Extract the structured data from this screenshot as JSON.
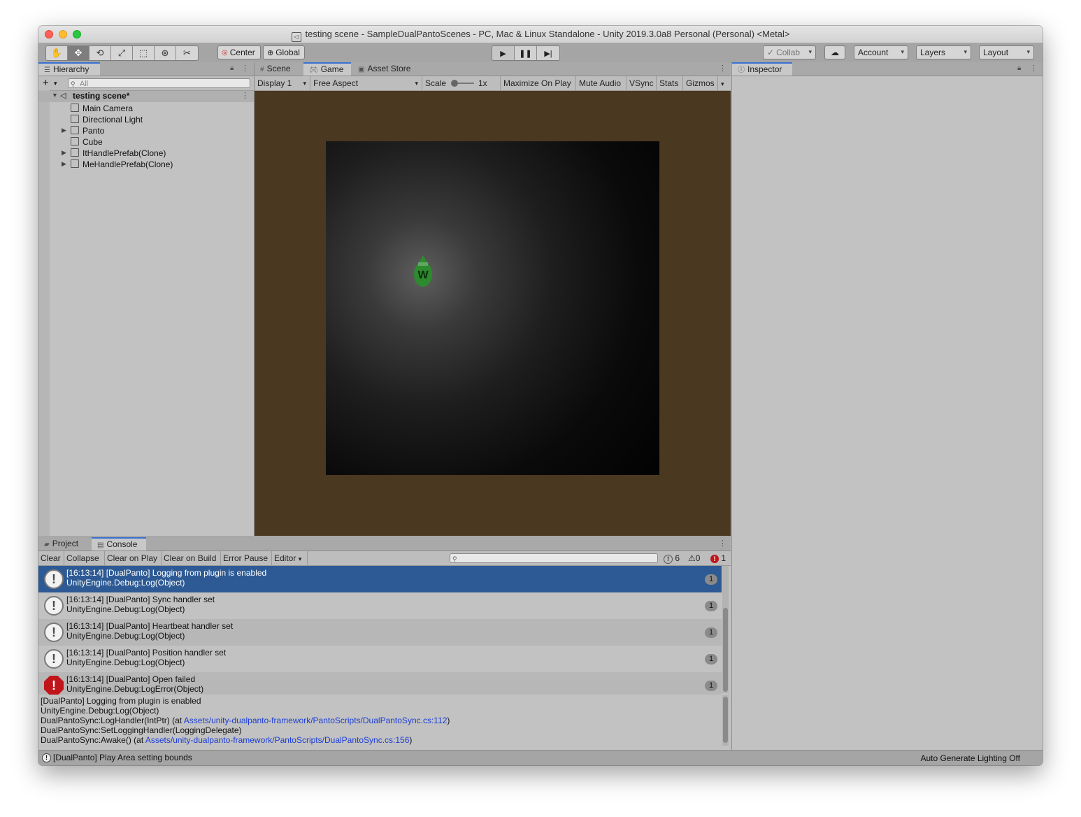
{
  "window": {
    "title": "testing scene - SampleDualPantoScenes - PC, Mac & Linux Standalone - Unity 2019.3.0a8 Personal (Personal) <Metal>"
  },
  "toolbar": {
    "pivot_label": "Center",
    "space_label": "Global",
    "collab_label": "Collab",
    "account_label": "Account",
    "layers_label": "Layers",
    "layout_label": "Layout"
  },
  "hierarchy": {
    "tab_label": "Hierarchy",
    "search_placeholder": "All",
    "scene_name": "testing scene*",
    "items": [
      {
        "label": "Main Camera"
      },
      {
        "label": "Directional Light"
      },
      {
        "label": "Panto"
      },
      {
        "label": "Cube"
      },
      {
        "label": "ItHandlePrefab(Clone)"
      },
      {
        "label": "MeHandlePrefab(Clone)"
      }
    ]
  },
  "center_tabs": {
    "scene": "Scene",
    "game": "Game",
    "asset_store": "Asset Store"
  },
  "game_toolbar": {
    "display": "Display 1",
    "aspect": "Free Aspect",
    "scale_label": "Scale",
    "scale_value": "1x",
    "maximize": "Maximize On Play",
    "mute": "Mute Audio",
    "vsync": "VSync",
    "stats": "Stats",
    "gizmos": "Gizmos"
  },
  "game_view": {
    "handle_glyph": "W",
    "colors": {
      "background": "#4a3820",
      "handle": "#2e8a2e"
    }
  },
  "inspector": {
    "tab_label": "Inspector"
  },
  "console": {
    "tab_project": "Project",
    "tab_console": "Console",
    "buttons": {
      "clear": "Clear",
      "collapse": "Collapse",
      "clear_on_play": "Clear on Play",
      "clear_on_build": "Clear on Build",
      "error_pause": "Error Pause",
      "editor": "Editor"
    },
    "counts": {
      "log": "6",
      "warning": "0",
      "error": "1"
    },
    "entries": [
      {
        "line1": "[16:13:14] [DualPanto] Logging from plugin is enabled",
        "line2": "UnityEngine.Debug:Log(Object)",
        "count": "1"
      },
      {
        "line1": "[16:13:14] [DualPanto] Sync handler set",
        "line2": "UnityEngine.Debug:Log(Object)",
        "count": "1"
      },
      {
        "line1": "[16:13:14] [DualPanto] Heartbeat handler set",
        "line2": "UnityEngine.Debug:Log(Object)",
        "count": "1"
      },
      {
        "line1": "[16:13:14] [DualPanto] Position handler set",
        "line2": "UnityEngine.Debug:Log(Object)",
        "count": "1"
      },
      {
        "line1": "[16:13:14] [DualPanto] Open failed",
        "line2": "UnityEngine.Debug:LogError(Object)",
        "count": "1"
      }
    ],
    "detail": {
      "line1": "[DualPanto] Logging from plugin is enabled",
      "line2": "UnityEngine.Debug:Log(Object)",
      "line3_prefix": "DualPantoSync:LogHandler(IntPtr) (at ",
      "line3_link": "Assets/unity-dualpanto-framework/PantoScripts/DualPantoSync.cs:112",
      "line3_suffix": ")",
      "line4": "DualPantoSync:SetLoggingHandler(LoggingDelegate)",
      "line5_prefix": "DualPantoSync:Awake() (at ",
      "line5_link": "Assets/unity-dualpanto-framework/PantoScripts/DualPantoSync.cs:156",
      "line5_suffix": ")"
    },
    "colors": {
      "selected_row": "#2d5a94",
      "row_alt": "#b7b7b7",
      "error_icon": "#c0151b"
    }
  },
  "statusbar": {
    "message": "[DualPanto] Play Area setting bounds",
    "right": "Auto Generate Lighting Off"
  }
}
